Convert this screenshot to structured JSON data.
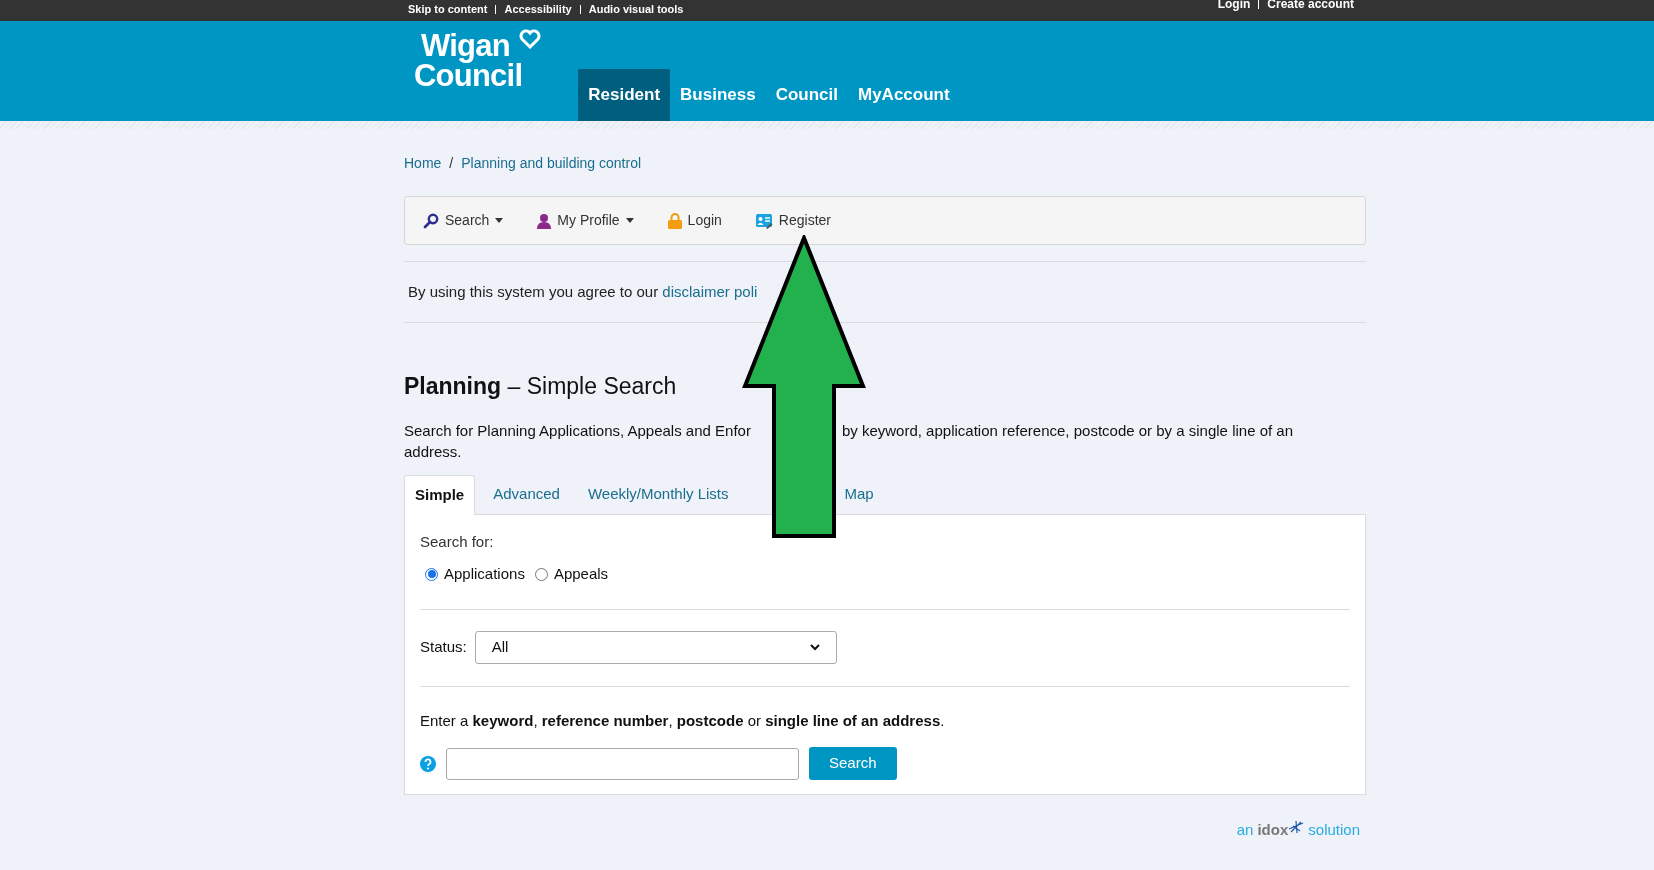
{
  "top_bar": {
    "links": [
      "Skip to content",
      "Accessibility",
      "Audio visual tools"
    ],
    "account_links": [
      "Login",
      "Create account"
    ]
  },
  "header": {
    "logo": {
      "line1": "Wigan",
      "line2": "Council"
    },
    "nav": [
      {
        "label": "Resident",
        "selected": true
      },
      {
        "label": "Business",
        "selected": false
      },
      {
        "label": "Council",
        "selected": false
      },
      {
        "label": "MyAccount",
        "selected": false
      }
    ]
  },
  "breadcrumb": {
    "items": [
      "Home",
      "Planning and building control"
    ],
    "separator": "/"
  },
  "toolbar": [
    {
      "label": "Search",
      "kind": "search",
      "dropdown": true
    },
    {
      "label": "My Profile",
      "kind": "profile",
      "dropdown": true
    },
    {
      "label": "Login",
      "kind": "login",
      "dropdown": false
    },
    {
      "label": "Register",
      "kind": "register",
      "dropdown": false
    }
  ],
  "notice": {
    "text": "By using this system you agree to our",
    "link": "disclaimer poli"
  },
  "heading": "**Planning** – Simple Search",
  "description": {
    "before": "Search for Planning Applications, Appeals and Enfor",
    "after": "by keyword, application reference, postcode or by a single line of an",
    "continued": "address."
  },
  "tabs": [
    {
      "label": "Simple",
      "selected": true
    },
    {
      "label": "Advanced",
      "selected": false
    },
    {
      "label": "Weekly/Monthly Lists",
      "selected": false
    },
    {
      "label": "Map",
      "selected": false
    }
  ],
  "search_for": {
    "label": "Search for:",
    "options": [
      {
        "label": "Applications",
        "selected": true
      },
      {
        "label": "Appeals",
        "selected": false
      }
    ]
  },
  "status": {
    "label": "Status:",
    "value": "All"
  },
  "keyword": {
    "instruction": "Enter a **keyword**, **reference number**, **postcode** or **single line of an address**.",
    "button": "Search"
  },
  "footer": {
    "prefix": "an",
    "brand": "idox",
    "suffix": "solution"
  }
}
